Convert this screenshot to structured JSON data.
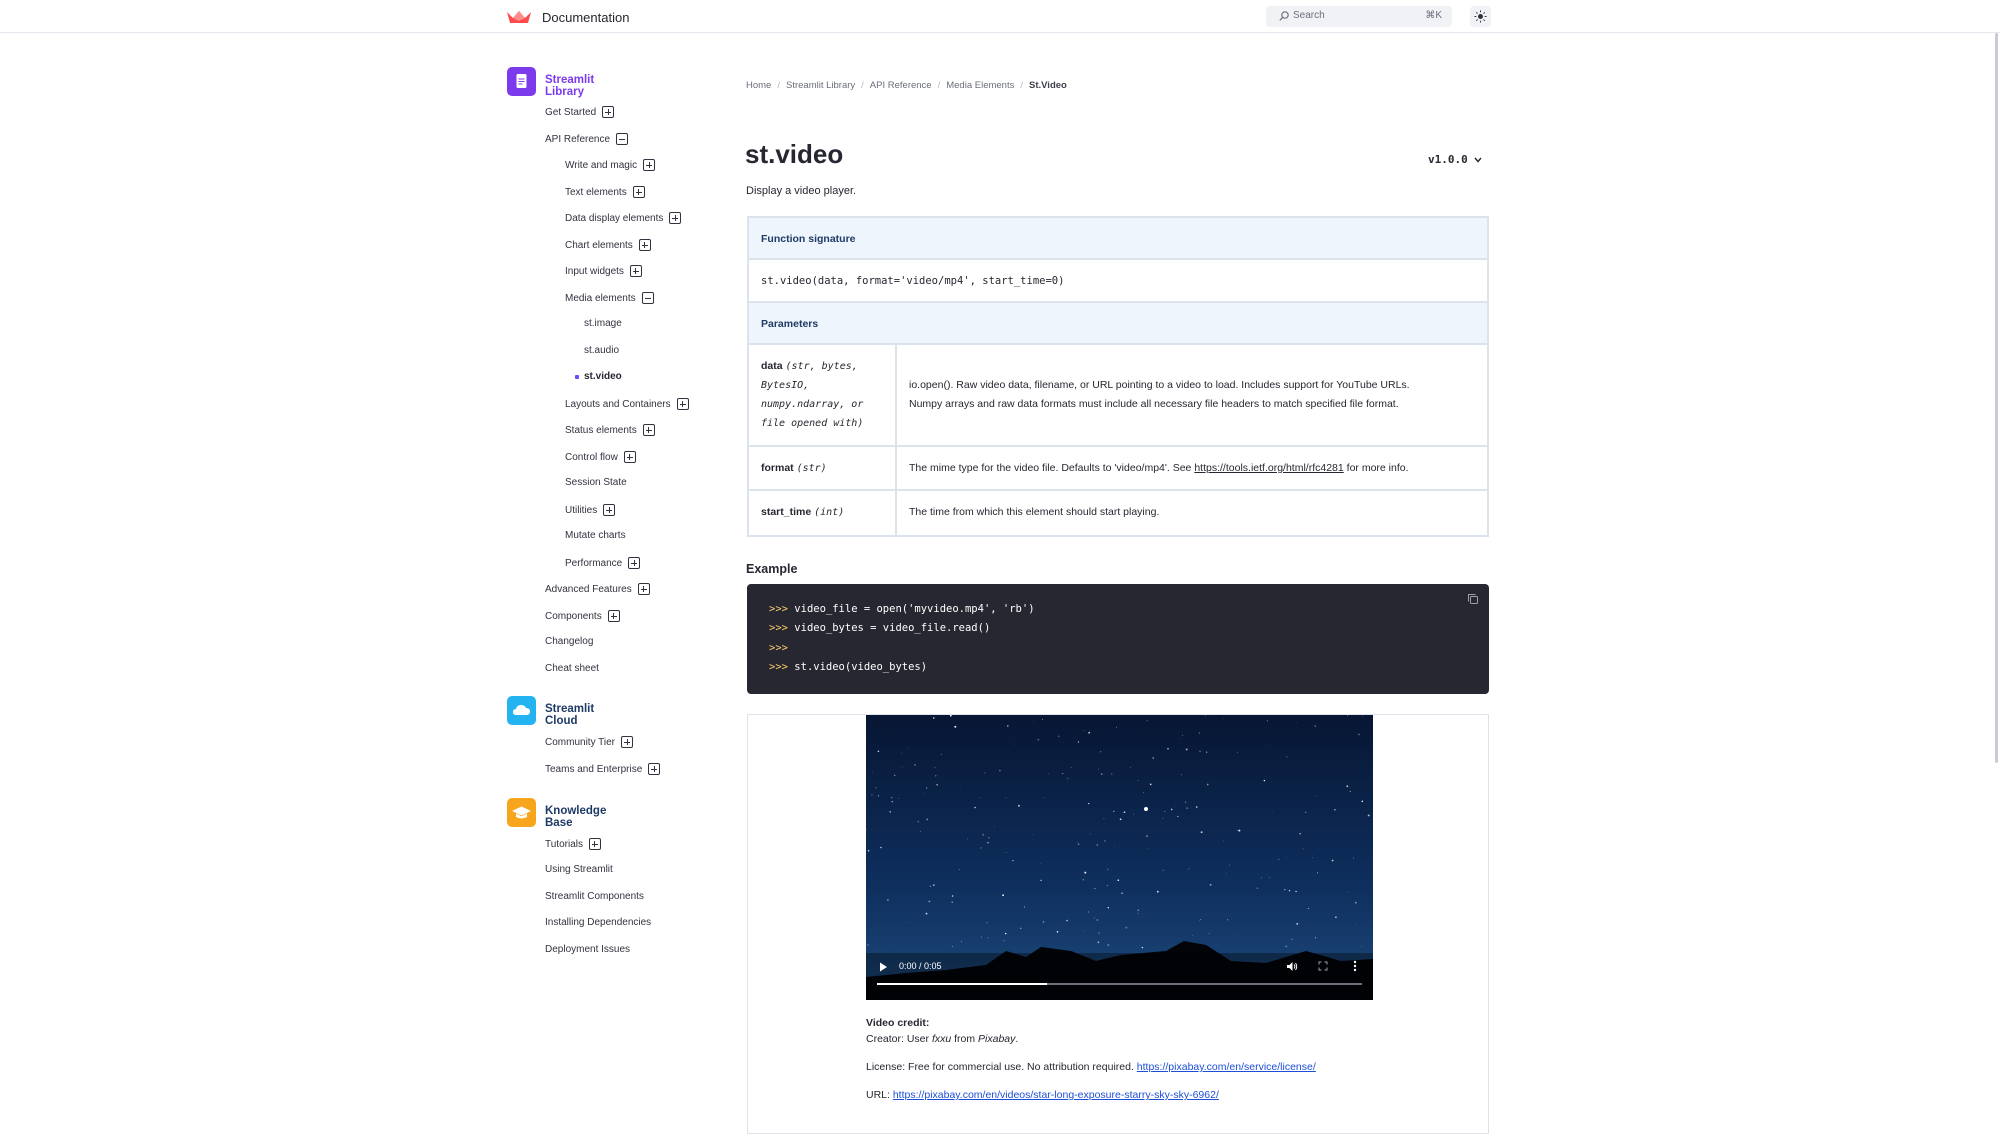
{
  "header": {
    "title": "Documentation",
    "search_placeholder": "Search",
    "search_shortcut": "⌘K"
  },
  "colors": {
    "library": "#7c3aed",
    "cloud": "#22b3f0",
    "knowledge": "#f7a51c",
    "accent": "#6a4cff"
  },
  "sidebar": {
    "sections": [
      {
        "title": "Streamlit Library",
        "icon": "document-icon"
      },
      {
        "title": "Streamlit Cloud",
        "icon": "cloud-icon"
      },
      {
        "title": "Knowledge Base",
        "icon": "graduation-cap-icon"
      }
    ],
    "items": [
      {
        "label": "Get Started",
        "toggle": "plus"
      },
      {
        "label": "API Reference",
        "toggle": "minus"
      },
      {
        "label": "Write and magic",
        "toggle": "plus"
      },
      {
        "label": "Text elements",
        "toggle": "plus"
      },
      {
        "label": "Data display elements",
        "toggle": "plus"
      },
      {
        "label": "Chart elements",
        "toggle": "plus"
      },
      {
        "label": "Input widgets",
        "toggle": "plus"
      },
      {
        "label": "Media elements",
        "toggle": "minus"
      },
      {
        "label": "st.image",
        "toggle": ""
      },
      {
        "label": "st.audio",
        "toggle": ""
      },
      {
        "label": "st.video",
        "toggle": ""
      },
      {
        "label": "Layouts and Containers",
        "toggle": "plus"
      },
      {
        "label": "Status elements",
        "toggle": "plus"
      },
      {
        "label": "Control flow",
        "toggle": "plus"
      },
      {
        "label": "Session State",
        "toggle": ""
      },
      {
        "label": "Utilities",
        "toggle": "plus"
      },
      {
        "label": "Mutate charts",
        "toggle": ""
      },
      {
        "label": "Performance",
        "toggle": "plus"
      },
      {
        "label": "Advanced Features",
        "toggle": "plus"
      },
      {
        "label": "Components",
        "toggle": "plus"
      },
      {
        "label": "Changelog",
        "toggle": ""
      },
      {
        "label": "Cheat sheet",
        "toggle": ""
      },
      {
        "label": "Community Tier",
        "toggle": "plus"
      },
      {
        "label": "Teams and Enterprise",
        "toggle": "plus"
      },
      {
        "label": "Tutorials",
        "toggle": "plus"
      },
      {
        "label": "Using Streamlit",
        "toggle": ""
      },
      {
        "label": "Streamlit Components",
        "toggle": ""
      },
      {
        "label": "Installing Dependencies",
        "toggle": ""
      },
      {
        "label": "Deployment Issues",
        "toggle": ""
      }
    ],
    "active_item": "st.video"
  },
  "breadcrumb": [
    "Home",
    "Streamlit Library",
    "API Reference",
    "Media Elements",
    "St.Video"
  ],
  "page": {
    "title": "st.video",
    "version": "v1.0.0",
    "subtitle": "Display a video player."
  },
  "signature": {
    "heading": "Function signature",
    "code": "st.video(data, format='video/mp4', start_time=0)",
    "params_heading": "Parameters",
    "params": [
      {
        "name": "data",
        "type_lines": [
          "(str, bytes,",
          "BytesIO,",
          "numpy.ndarray, or",
          "file opened with)"
        ],
        "desc_lines": [
          "io.open(). Raw video data, filename, or URL pointing to a video to load. Includes support for YouTube URLs.",
          "Numpy arrays and raw data formats must include all necessary file headers to match specified file format."
        ]
      },
      {
        "name": "format",
        "type": "(str)",
        "desc_before": "The mime type for the video file. Defaults to 'video/mp4'. See ",
        "desc_link": "https://tools.ietf.org/html/rfc4281",
        "desc_after": " for more info."
      },
      {
        "name": "start_time",
        "type": "(int)",
        "desc": "The time from which this element should start playing."
      }
    ]
  },
  "example": {
    "heading": "Example",
    "lines": [
      {
        "prompt": ">>>",
        "code": "video_file = open('myvideo.mp4', 'rb')"
      },
      {
        "prompt": ">>>",
        "code": "video_bytes = video_file.read()"
      },
      {
        "prompt": ">>>",
        "code": ""
      },
      {
        "prompt": ">>>",
        "code": "st.video(video_bytes)"
      }
    ]
  },
  "video": {
    "time": "0:00 / 0:05",
    "progress": 0.35
  },
  "credits": {
    "heading": "Video credit:",
    "creator_prefix": "Creator: User ",
    "creator_user": "fxxu",
    "creator_mid": " from ",
    "creator_site": "Pixabay",
    "creator_suffix": ".",
    "license_prefix": "License: Free for commercial use. No attribution required. ",
    "license_link": "https://pixabay.com/en/service/license/",
    "url_prefix": "URL: ",
    "url_link": "https://pixabay.com/en/videos/star-long-exposure-starry-sky-sky-6962/"
  }
}
